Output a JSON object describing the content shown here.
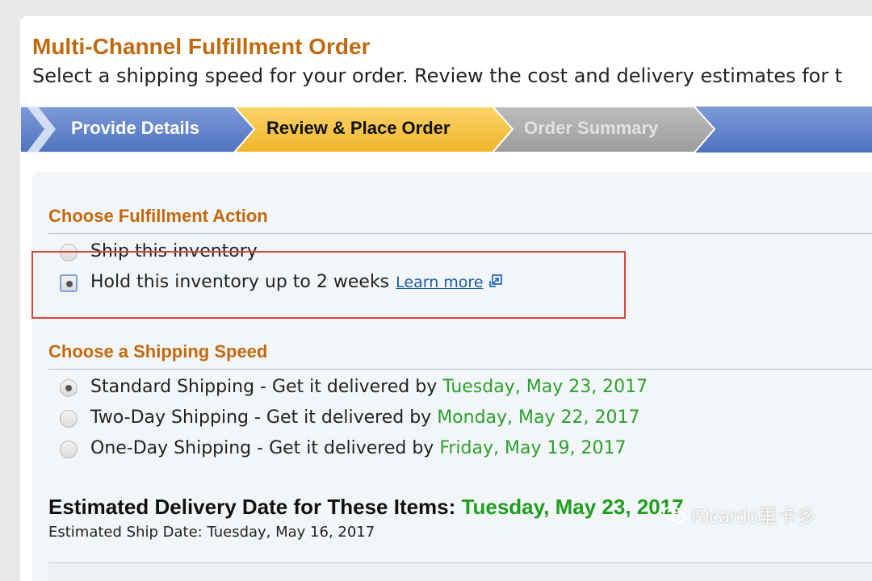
{
  "header": {
    "title": "Multi-Channel Fulfillment Order",
    "subtitle": "Select a shipping speed for your order. Review the cost and delivery estimates for t"
  },
  "steps": [
    {
      "label": "Provide Details",
      "state": "done"
    },
    {
      "label": "Review & Place Order",
      "state": "current"
    },
    {
      "label": "Order Summary",
      "state": "upcoming"
    }
  ],
  "fulfillment": {
    "title": "Choose Fulfillment Action",
    "options": [
      {
        "label": "Ship this inventory",
        "selected": false
      },
      {
        "label": "Hold this inventory up to 2 weeks",
        "selected": true
      }
    ],
    "learn_more": "Learn more"
  },
  "shipping": {
    "title": "Choose a Shipping Speed",
    "options": [
      {
        "label": "Standard Shipping - Get it delivered by",
        "date": "Tuesday, May 23, 2017",
        "selected": true
      },
      {
        "label": "Two-Day Shipping - Get it delivered by",
        "date": "Monday, May 22, 2017",
        "selected": false
      },
      {
        "label": "One-Day Shipping - Get it delivered by",
        "date": "Friday, May 19, 2017",
        "selected": false
      }
    ]
  },
  "estimate": {
    "label": "Estimated Delivery Date for These Items:",
    "date": "Tuesday, May 23, 2017",
    "ship_date": "Estimated Ship Date: Tuesday, May 16, 2017"
  },
  "watermark": {
    "text": "Ricardo里卡多"
  },
  "colors": {
    "accent_orange": "#c2690e",
    "step_blue": "#5b7fca",
    "step_yellow": "#f5c242",
    "step_gray": "#a8a8a8",
    "date_green": "#2aa02a",
    "highlight_red": "#d9463a",
    "link_blue": "#1a5aa8"
  }
}
